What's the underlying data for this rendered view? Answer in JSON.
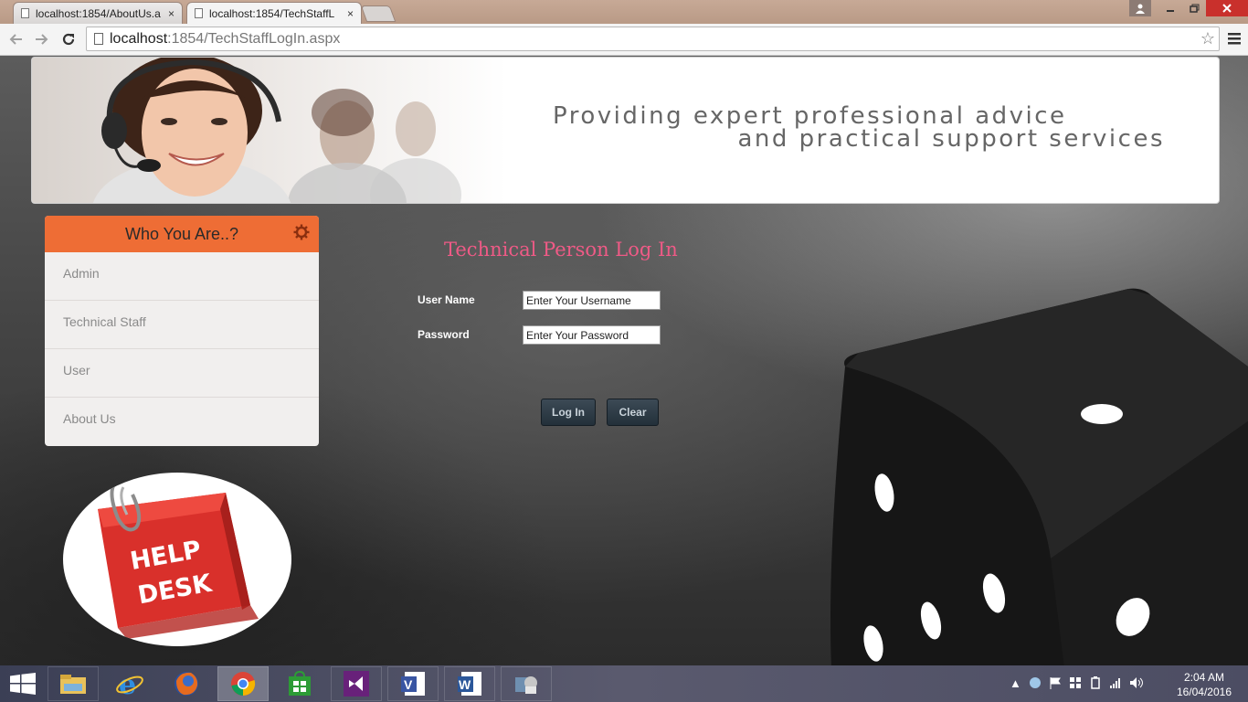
{
  "browser": {
    "tabs": [
      {
        "label": "localhost:1854/AboutUs.a",
        "close": "×"
      },
      {
        "label": "localhost:1854/TechStaffL",
        "close": "×"
      }
    ],
    "address": {
      "host": "localhost",
      "rest": ":1854/TechStaffLogIn.aspx"
    },
    "icons": [
      "back-arrow-icon",
      "forward-arrow-icon",
      "reload-icon",
      "star-icon",
      "menu-icon"
    ]
  },
  "banner": {
    "line1": "Providing expert professional advice",
    "line2": "and practical support services"
  },
  "sidebar": {
    "title": "Who You Are..?",
    "items": [
      {
        "label": "Admin"
      },
      {
        "label": "Technical Staff"
      },
      {
        "label": "User"
      },
      {
        "label": "About Us"
      }
    ]
  },
  "helpdesk": {
    "line1": "HELP",
    "line2": "DESK"
  },
  "login": {
    "title": "Technical Person Log In",
    "username_label": "User Name",
    "username_value": "Enter Your Username",
    "password_label": "Password",
    "password_value": "Enter Your Password",
    "login_button": "Log In",
    "clear_button": "Clear"
  },
  "colors": {
    "sidebar_header": "#ee6d35",
    "login_title": "#ef5a86",
    "button": "#2c3944"
  },
  "taskbar": {
    "time": "2:04 AM",
    "date": "16/04/2016",
    "apps": [
      "file-explorer-icon",
      "internet-explorer-icon",
      "firefox-icon",
      "chrome-icon",
      "store-icon",
      "visual-studio-icon",
      "visio-icon",
      "word-icon",
      "app-icon"
    ]
  }
}
